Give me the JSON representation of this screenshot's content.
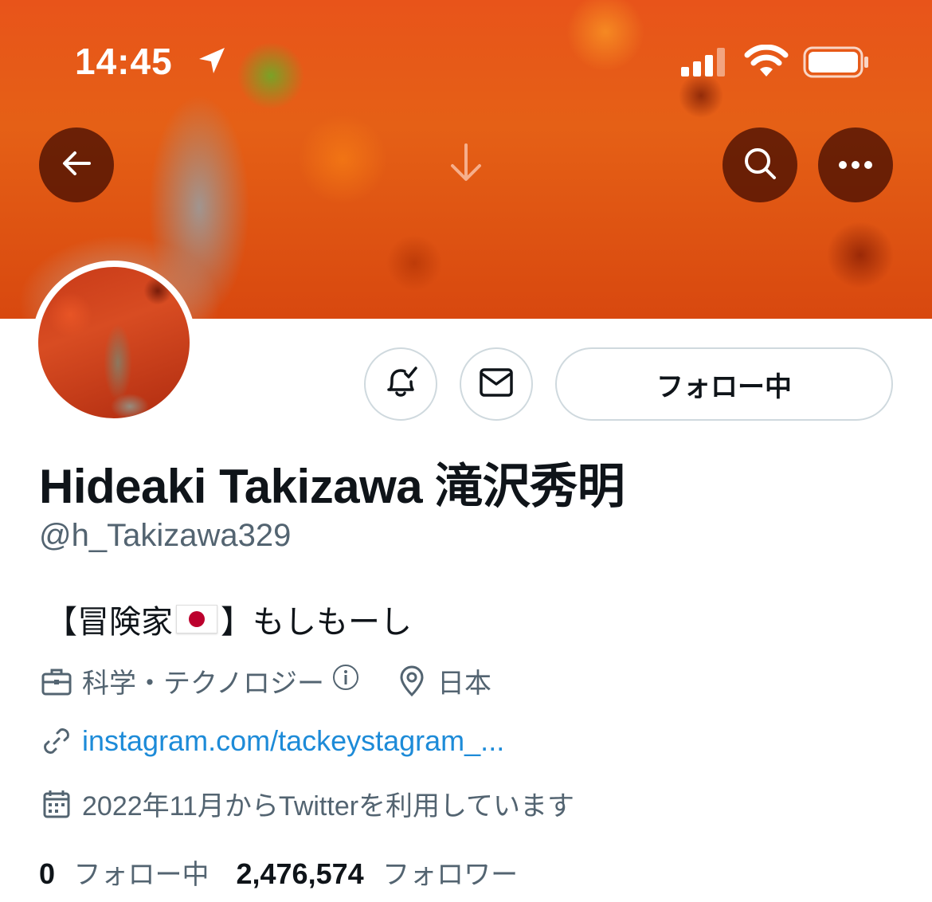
{
  "status_bar": {
    "time": "14:45"
  },
  "header": {
    "back_icon": "arrow-left-icon",
    "pull_icon": "arrow-down-icon",
    "search_icon": "search-icon",
    "more_icon": "more-horizontal-icon"
  },
  "profile": {
    "display_name": "Hideaki Takizawa 滝沢秀明",
    "handle": "@h_Takizawa329",
    "bio_before_flag": "【冒険家",
    "bio_after_flag": "】もしもーし",
    "category": "科学・テクノロジー",
    "location": "日本",
    "website": "instagram.com/tackeystagram_...",
    "joined": "2022年11月からTwitterを利用しています"
  },
  "actions": {
    "follow_label": "フォロー中"
  },
  "stats": {
    "following_count": "0",
    "following_label": "フォロー中",
    "followers_count": "2,476,574",
    "followers_label": "フォロワー"
  },
  "colors": {
    "accent_link": "#1d8bd8",
    "secondary_text": "#536471",
    "primary_text": "#0f1419",
    "border": "#cfd9de"
  }
}
